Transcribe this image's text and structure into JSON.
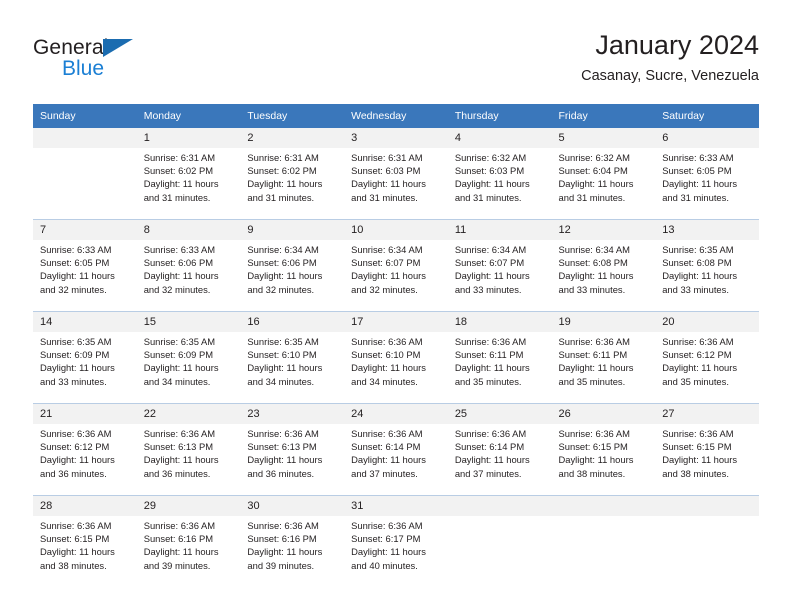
{
  "brand": {
    "name_part1": "General",
    "name_part2": "Blue",
    "accent_color": "#1b7fd4",
    "triangle_color": "#1b6cb0"
  },
  "header": {
    "title": "January 2024",
    "subtitle": "Casanay, Sucre, Venezuela",
    "header_bg_color": "#3a77bb"
  },
  "calendar": {
    "weekday_headers": [
      "Sunday",
      "Monday",
      "Tuesday",
      "Wednesday",
      "Thursday",
      "Friday",
      "Saturday"
    ],
    "weeks": [
      [
        {
          "day": "",
          "sunrise": "",
          "sunset": "",
          "daylight1": "",
          "daylight2": "",
          "empty": true
        },
        {
          "day": "1",
          "sunrise": "Sunrise: 6:31 AM",
          "sunset": "Sunset: 6:02 PM",
          "daylight1": "Daylight: 11 hours",
          "daylight2": "and 31 minutes.",
          "empty": false
        },
        {
          "day": "2",
          "sunrise": "Sunrise: 6:31 AM",
          "sunset": "Sunset: 6:02 PM",
          "daylight1": "Daylight: 11 hours",
          "daylight2": "and 31 minutes.",
          "empty": false
        },
        {
          "day": "3",
          "sunrise": "Sunrise: 6:31 AM",
          "sunset": "Sunset: 6:03 PM",
          "daylight1": "Daylight: 11 hours",
          "daylight2": "and 31 minutes.",
          "empty": false
        },
        {
          "day": "4",
          "sunrise": "Sunrise: 6:32 AM",
          "sunset": "Sunset: 6:03 PM",
          "daylight1": "Daylight: 11 hours",
          "daylight2": "and 31 minutes.",
          "empty": false
        },
        {
          "day": "5",
          "sunrise": "Sunrise: 6:32 AM",
          "sunset": "Sunset: 6:04 PM",
          "daylight1": "Daylight: 11 hours",
          "daylight2": "and 31 minutes.",
          "empty": false
        },
        {
          "day": "6",
          "sunrise": "Sunrise: 6:33 AM",
          "sunset": "Sunset: 6:05 PM",
          "daylight1": "Daylight: 11 hours",
          "daylight2": "and 31 minutes.",
          "empty": false
        }
      ],
      [
        {
          "day": "7",
          "sunrise": "Sunrise: 6:33 AM",
          "sunset": "Sunset: 6:05 PM",
          "daylight1": "Daylight: 11 hours",
          "daylight2": "and 32 minutes.",
          "empty": false
        },
        {
          "day": "8",
          "sunrise": "Sunrise: 6:33 AM",
          "sunset": "Sunset: 6:06 PM",
          "daylight1": "Daylight: 11 hours",
          "daylight2": "and 32 minutes.",
          "empty": false
        },
        {
          "day": "9",
          "sunrise": "Sunrise: 6:34 AM",
          "sunset": "Sunset: 6:06 PM",
          "daylight1": "Daylight: 11 hours",
          "daylight2": "and 32 minutes.",
          "empty": false
        },
        {
          "day": "10",
          "sunrise": "Sunrise: 6:34 AM",
          "sunset": "Sunset: 6:07 PM",
          "daylight1": "Daylight: 11 hours",
          "daylight2": "and 32 minutes.",
          "empty": false
        },
        {
          "day": "11",
          "sunrise": "Sunrise: 6:34 AM",
          "sunset": "Sunset: 6:07 PM",
          "daylight1": "Daylight: 11 hours",
          "daylight2": "and 33 minutes.",
          "empty": false
        },
        {
          "day": "12",
          "sunrise": "Sunrise: 6:34 AM",
          "sunset": "Sunset: 6:08 PM",
          "daylight1": "Daylight: 11 hours",
          "daylight2": "and 33 minutes.",
          "empty": false
        },
        {
          "day": "13",
          "sunrise": "Sunrise: 6:35 AM",
          "sunset": "Sunset: 6:08 PM",
          "daylight1": "Daylight: 11 hours",
          "daylight2": "and 33 minutes.",
          "empty": false
        }
      ],
      [
        {
          "day": "14",
          "sunrise": "Sunrise: 6:35 AM",
          "sunset": "Sunset: 6:09 PM",
          "daylight1": "Daylight: 11 hours",
          "daylight2": "and 33 minutes.",
          "empty": false
        },
        {
          "day": "15",
          "sunrise": "Sunrise: 6:35 AM",
          "sunset": "Sunset: 6:09 PM",
          "daylight1": "Daylight: 11 hours",
          "daylight2": "and 34 minutes.",
          "empty": false
        },
        {
          "day": "16",
          "sunrise": "Sunrise: 6:35 AM",
          "sunset": "Sunset: 6:10 PM",
          "daylight1": "Daylight: 11 hours",
          "daylight2": "and 34 minutes.",
          "empty": false
        },
        {
          "day": "17",
          "sunrise": "Sunrise: 6:36 AM",
          "sunset": "Sunset: 6:10 PM",
          "daylight1": "Daylight: 11 hours",
          "daylight2": "and 34 minutes.",
          "empty": false
        },
        {
          "day": "18",
          "sunrise": "Sunrise: 6:36 AM",
          "sunset": "Sunset: 6:11 PM",
          "daylight1": "Daylight: 11 hours",
          "daylight2": "and 35 minutes.",
          "empty": false
        },
        {
          "day": "19",
          "sunrise": "Sunrise: 6:36 AM",
          "sunset": "Sunset: 6:11 PM",
          "daylight1": "Daylight: 11 hours",
          "daylight2": "and 35 minutes.",
          "empty": false
        },
        {
          "day": "20",
          "sunrise": "Sunrise: 6:36 AM",
          "sunset": "Sunset: 6:12 PM",
          "daylight1": "Daylight: 11 hours",
          "daylight2": "and 35 minutes.",
          "empty": false
        }
      ],
      [
        {
          "day": "21",
          "sunrise": "Sunrise: 6:36 AM",
          "sunset": "Sunset: 6:12 PM",
          "daylight1": "Daylight: 11 hours",
          "daylight2": "and 36 minutes.",
          "empty": false
        },
        {
          "day": "22",
          "sunrise": "Sunrise: 6:36 AM",
          "sunset": "Sunset: 6:13 PM",
          "daylight1": "Daylight: 11 hours",
          "daylight2": "and 36 minutes.",
          "empty": false
        },
        {
          "day": "23",
          "sunrise": "Sunrise: 6:36 AM",
          "sunset": "Sunset: 6:13 PM",
          "daylight1": "Daylight: 11 hours",
          "daylight2": "and 36 minutes.",
          "empty": false
        },
        {
          "day": "24",
          "sunrise": "Sunrise: 6:36 AM",
          "sunset": "Sunset: 6:14 PM",
          "daylight1": "Daylight: 11 hours",
          "daylight2": "and 37 minutes.",
          "empty": false
        },
        {
          "day": "25",
          "sunrise": "Sunrise: 6:36 AM",
          "sunset": "Sunset: 6:14 PM",
          "daylight1": "Daylight: 11 hours",
          "daylight2": "and 37 minutes.",
          "empty": false
        },
        {
          "day": "26",
          "sunrise": "Sunrise: 6:36 AM",
          "sunset": "Sunset: 6:15 PM",
          "daylight1": "Daylight: 11 hours",
          "daylight2": "and 38 minutes.",
          "empty": false
        },
        {
          "day": "27",
          "sunrise": "Sunrise: 6:36 AM",
          "sunset": "Sunset: 6:15 PM",
          "daylight1": "Daylight: 11 hours",
          "daylight2": "and 38 minutes.",
          "empty": false
        }
      ],
      [
        {
          "day": "28",
          "sunrise": "Sunrise: 6:36 AM",
          "sunset": "Sunset: 6:15 PM",
          "daylight1": "Daylight: 11 hours",
          "daylight2": "and 38 minutes.",
          "empty": false
        },
        {
          "day": "29",
          "sunrise": "Sunrise: 6:36 AM",
          "sunset": "Sunset: 6:16 PM",
          "daylight1": "Daylight: 11 hours",
          "daylight2": "and 39 minutes.",
          "empty": false
        },
        {
          "day": "30",
          "sunrise": "Sunrise: 6:36 AM",
          "sunset": "Sunset: 6:16 PM",
          "daylight1": "Daylight: 11 hours",
          "daylight2": "and 39 minutes.",
          "empty": false
        },
        {
          "day": "31",
          "sunrise": "Sunrise: 6:36 AM",
          "sunset": "Sunset: 6:17 PM",
          "daylight1": "Daylight: 11 hours",
          "daylight2": "and 40 minutes.",
          "empty": false
        },
        {
          "day": "",
          "sunrise": "",
          "sunset": "",
          "daylight1": "",
          "daylight2": "",
          "empty": true
        },
        {
          "day": "",
          "sunrise": "",
          "sunset": "",
          "daylight1": "",
          "daylight2": "",
          "empty": true
        },
        {
          "day": "",
          "sunrise": "",
          "sunset": "",
          "daylight1": "",
          "daylight2": "",
          "empty": true
        }
      ]
    ]
  }
}
